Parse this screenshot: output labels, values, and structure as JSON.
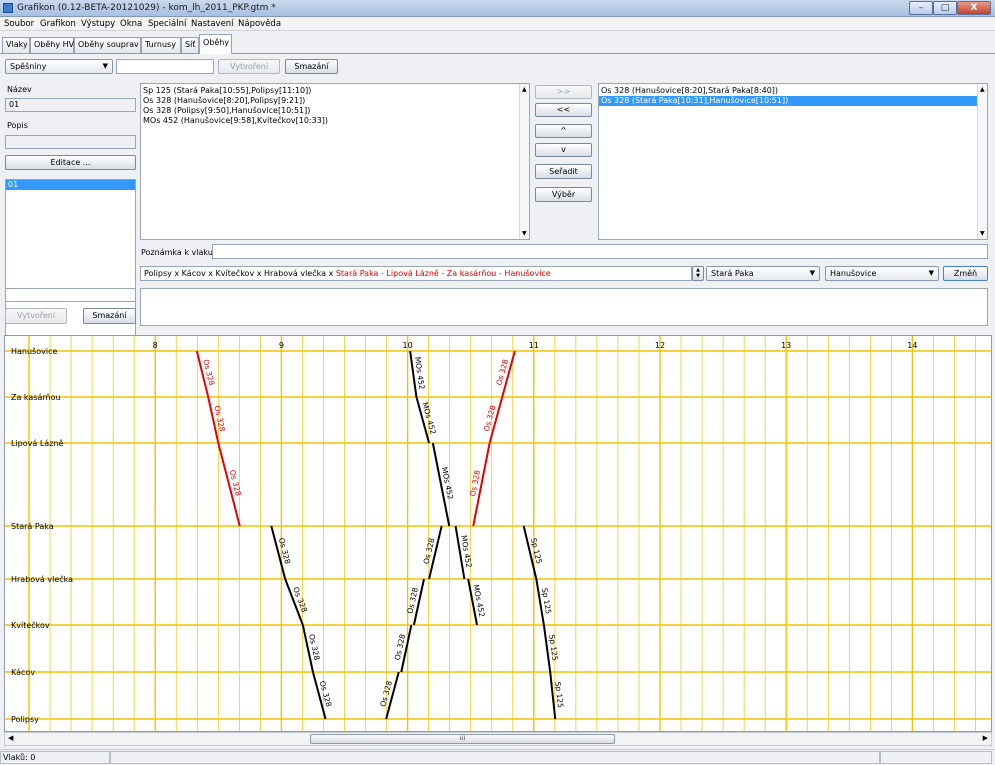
{
  "window": {
    "title": "Grafikon (0.12-BETA-20121029) - kom_lh_2011_PKP.gtm *",
    "min_glyph": "–",
    "max_glyph": "□",
    "close_glyph": "X",
    "icon": "app-icon"
  },
  "menu": [
    "Soubor",
    "Grafikon",
    "Výstupy",
    "Okna",
    "Speciální",
    "Nastavení",
    "Nápověda"
  ],
  "tabs": [
    "Vlaky",
    "Oběhy HV",
    "Oběhy souprav",
    "Turnusy",
    "Síť",
    "Oběhy"
  ],
  "active_tab": "Oběhy",
  "toolbar": {
    "type_combo": "Spěšniny",
    "name_input": "",
    "create_label": "Vytvoření",
    "delete_label": "Smazání"
  },
  "left_panel": {
    "name_label": "Název",
    "name_value": "01",
    "desc_label": "Popis",
    "desc_value": "",
    "edit_label": "Editace ...",
    "list": [
      "01"
    ],
    "new_input": "",
    "create_label": "Vytvoření",
    "delete_label": "Smazání"
  },
  "available_trains": [
    "Sp 125 (Stará Paka[10:55],Polipsy[11:10])",
    "Os 328 (Hanušovice[8:20],Polipsy[9:21])",
    "Os 328 (Polipsy[9:50],Hanušovice[10:51])",
    "MOs 452 (Hanušovice[9:58],Kvítečkov[10:33])"
  ],
  "buttons": {
    "add_all": ">>",
    "remove": "<<",
    "up": "^",
    "down": "v",
    "sort": "Seřadit",
    "select": "Výběr"
  },
  "selected_trains": [
    "Os 328 (Hanušovice[8:20],Stará Paka[8:40])",
    "Os 328 (Stará Paka[10:31],Hanušovice[10:51])"
  ],
  "selected_index": 1,
  "note": {
    "label": "Poznámka k vlaku:",
    "value": ""
  },
  "route": {
    "black": "Polipsy x Kácov x Kvítečkov x Hrabová vlečka x ",
    "red": "Stará Paka - Lipová Lázně - Za kasárňou - Hanušovice",
    "from": "Stará Paka",
    "to": "Hanušovice",
    "change_label": "Změň"
  },
  "chart_data": {
    "type": "train-graph",
    "x_ticks": [
      "8",
      "9",
      "10",
      "11",
      "12",
      "13",
      "14"
    ],
    "stations": [
      "Hanušovice",
      "Za kasárňou",
      "Lipová Lázně",
      "Stará Paka",
      "Hrabová vlečka",
      "Kvítečkov",
      "Kácov",
      "Polipsy"
    ],
    "colors": {
      "grid": "#f0c400",
      "highlight": "#e60000",
      "normal": "#000000"
    },
    "trains": [
      {
        "name": "Os 328",
        "highlight": true,
        "segments": [
          {
            "from": "Hanušovice",
            "to": "Za kasárňou",
            "dep": 8.33,
            "arr": 8.42
          },
          {
            "from": "Za kasárňou",
            "to": "Lipová Lázně",
            "dep": 8.42,
            "arr": 8.5
          },
          {
            "from": "Lipová Lázně",
            "to": "Stará Paka",
            "dep": 8.5,
            "arr": 8.67
          }
        ]
      },
      {
        "name": "Os 328",
        "highlight": false,
        "segments": [
          {
            "from": "Stará Paka",
            "to": "Hrabová vlečka",
            "dep": 8.92,
            "arr": 9.03
          },
          {
            "from": "Hrabová vlečka",
            "to": "Kvítečkov",
            "dep": 9.03,
            "arr": 9.17
          },
          {
            "from": "Kvítečkov",
            "to": "Kácov",
            "dep": 9.17,
            "arr": 9.25
          },
          {
            "from": "Kácov",
            "to": "Polipsy",
            "dep": 9.25,
            "arr": 9.35
          }
        ]
      },
      {
        "name": "MOs 452",
        "highlight": false,
        "segments": [
          {
            "from": "Hanušovice",
            "to": "Za kasárňou",
            "dep": 10.02,
            "arr": 10.07
          },
          {
            "from": "Za kasárňou",
            "to": "Lipová Lázně",
            "dep": 10.07,
            "arr": 10.17
          },
          {
            "from": "Lipová Lázně",
            "to": "Stará Paka",
            "dep": 10.2,
            "arr": 10.33
          },
          {
            "from": "Stará Paka",
            "to": "Hrabová vlečka",
            "dep": 10.38,
            "arr": 10.45
          },
          {
            "from": "Hrabová vlečka",
            "to": "Kvítečkov",
            "dep": 10.48,
            "arr": 10.55
          }
        ]
      },
      {
        "name": "Os 328",
        "highlight": false,
        "segments": [
          {
            "from": "Polipsy",
            "to": "Kácov",
            "dep": 9.83,
            "arr": 9.93
          },
          {
            "from": "Kácov",
            "to": "Kvítečkov",
            "dep": 9.95,
            "arr": 10.03
          },
          {
            "from": "Kvítečkov",
            "to": "Hrabová vlečka",
            "dep": 10.05,
            "arr": 10.13
          },
          {
            "from": "Hrabová vlečka",
            "to": "Stará Paka",
            "dep": 10.17,
            "arr": 10.27
          }
        ]
      },
      {
        "name": "Os 328",
        "highlight": true,
        "segments": [
          {
            "from": "Stará Paka",
            "to": "Lipová Lázně",
            "dep": 10.52,
            "arr": 10.65
          },
          {
            "from": "Lipová Lázně",
            "to": "Za kasárňou",
            "dep": 10.65,
            "arr": 10.75
          },
          {
            "from": "Za kasárňou",
            "to": "Hanušovice",
            "dep": 10.75,
            "arr": 10.85
          }
        ]
      },
      {
        "name": "Sp 125",
        "highlight": false,
        "segments": [
          {
            "from": "Stará Paka",
            "to": "Hrabová vlečka",
            "dep": 10.92,
            "arr": 11.02
          },
          {
            "from": "Hrabová vlečka",
            "to": "Kvítečkov",
            "dep": 11.02,
            "arr": 11.08
          },
          {
            "from": "Kvítečkov",
            "to": "Kácov",
            "dep": 11.08,
            "arr": 11.13
          },
          {
            "from": "Kácov",
            "to": "Polipsy",
            "dep": 11.13,
            "arr": 11.17
          }
        ]
      }
    ]
  },
  "status": {
    "text": "Vlaků: 0"
  }
}
